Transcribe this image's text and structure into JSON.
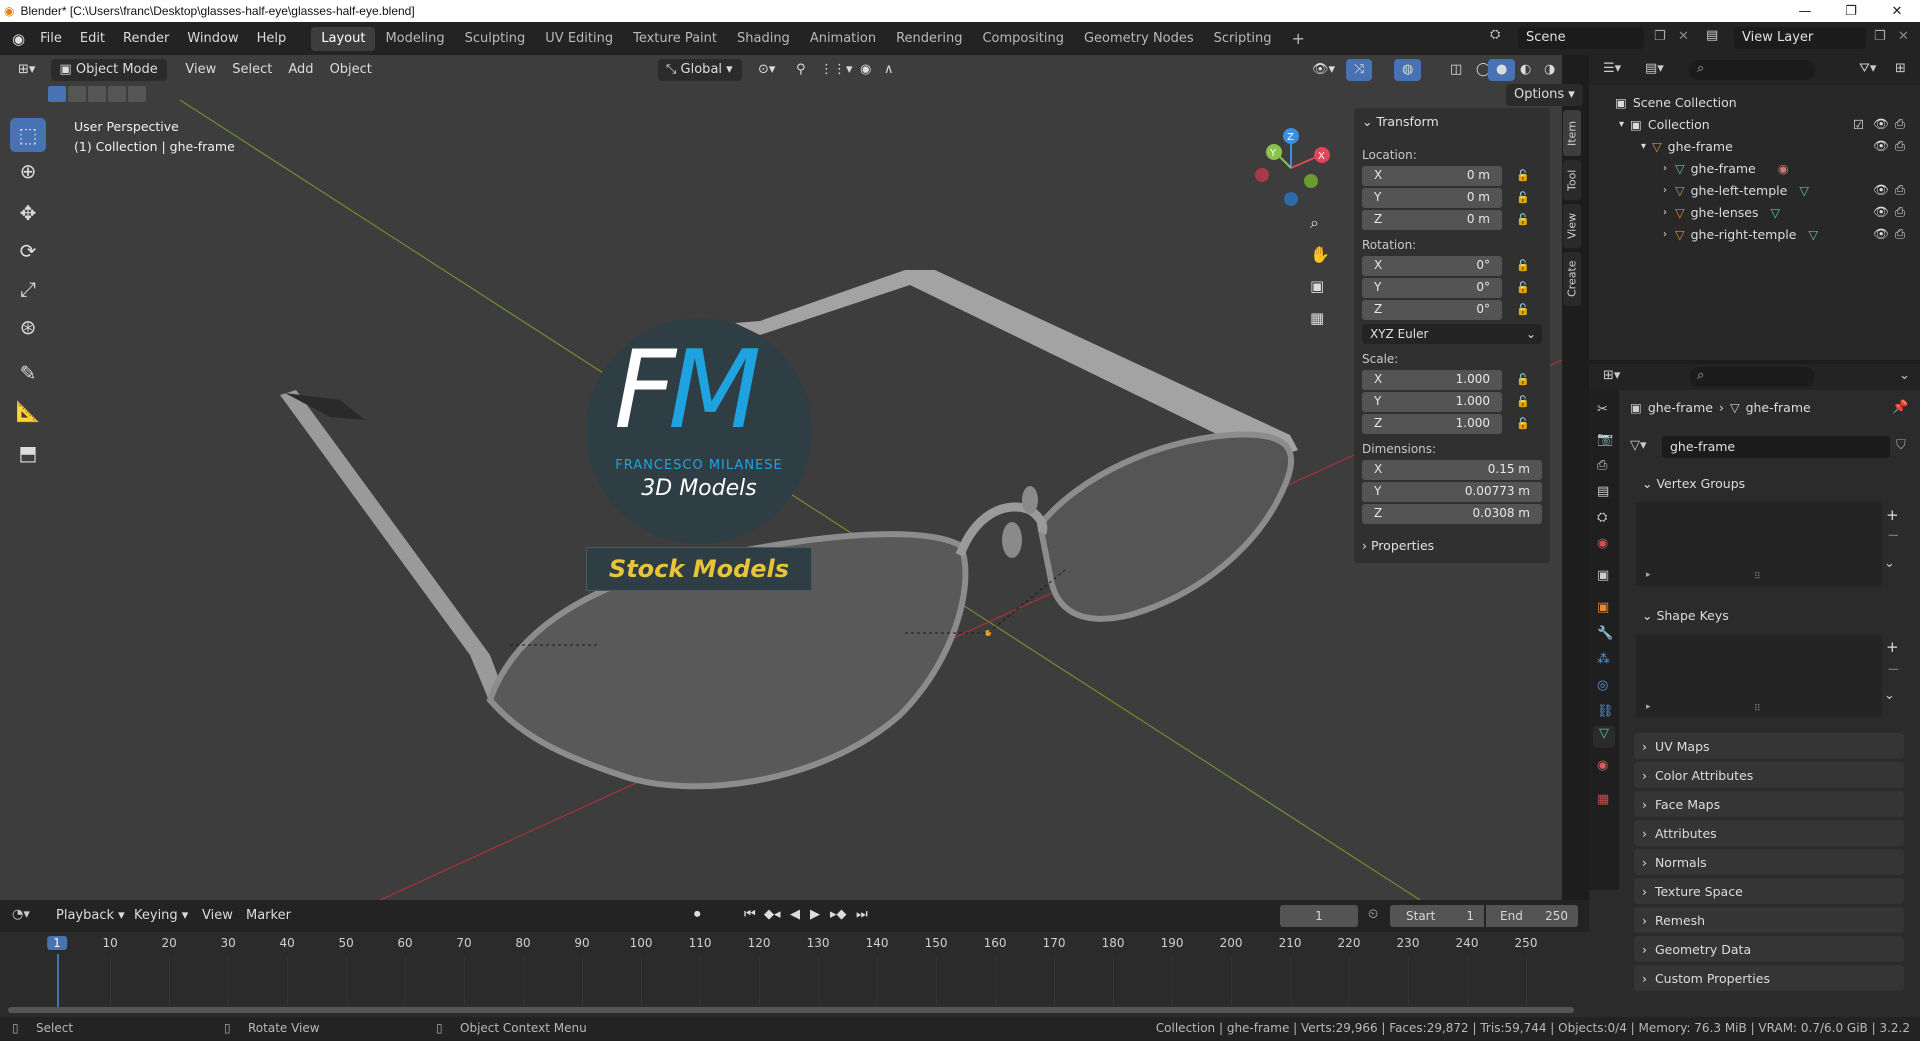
{
  "titlebar": {
    "title": "Blender* [C:\\Users\\franc\\Desktop\\glasses-half-eye\\glasses-half-eye.blend]",
    "minimize": "—",
    "maximize": "❐",
    "close": "✕"
  },
  "menu": [
    "File",
    "Edit",
    "Render",
    "Window",
    "Help"
  ],
  "workspaces": [
    "Layout",
    "Modeling",
    "Sculpting",
    "UV Editing",
    "Texture Paint",
    "Shading",
    "Animation",
    "Rendering",
    "Compositing",
    "Geometry Nodes",
    "Scripting"
  ],
  "active_workspace": "Layout",
  "add_workspace": "+",
  "scene": "Scene",
  "view_layer": "View Layer",
  "viewport_header": {
    "mode": "Object Mode",
    "view": "View",
    "select": "Select",
    "add": "Add",
    "object": "Object",
    "orientation": "Global",
    "options": "Options"
  },
  "viewport": {
    "perspective": "User Perspective",
    "collection_info": "(1) Collection | ghe-frame"
  },
  "watermark": {
    "letters_f": "F",
    "letters_m": "M",
    "author": "FRANCESCO MILANESE",
    "subtitle": "3D Models",
    "banner": "Stock Models"
  },
  "gizmo": {
    "x": "X",
    "y": "Y",
    "z": "Z"
  },
  "npanel": {
    "transform_header": "Transform",
    "location_label": "Location:",
    "location": [
      {
        "axis": "X",
        "value": "0 m"
      },
      {
        "axis": "Y",
        "value": "0 m"
      },
      {
        "axis": "Z",
        "value": "0 m"
      }
    ],
    "rotation_label": "Rotation:",
    "rotation": [
      {
        "axis": "X",
        "value": "0°"
      },
      {
        "axis": "Y",
        "value": "0°"
      },
      {
        "axis": "Z",
        "value": "0°"
      }
    ],
    "rotation_mode": "XYZ Euler",
    "scale_label": "Scale:",
    "scale": [
      {
        "axis": "X",
        "value": "1.000"
      },
      {
        "axis": "Y",
        "value": "1.000"
      },
      {
        "axis": "Z",
        "value": "1.000"
      }
    ],
    "dimensions_label": "Dimensions:",
    "dimensions": [
      {
        "axis": "X",
        "value": "0.15 m"
      },
      {
        "axis": "Y",
        "value": "0.00773 m"
      },
      {
        "axis": "Z",
        "value": "0.0308 m"
      }
    ],
    "properties_header": "Properties",
    "tabs": [
      "Item",
      "Tool",
      "View",
      "Create"
    ]
  },
  "outliner": {
    "scene_collection": "Scene Collection",
    "collection": "Collection",
    "items": [
      {
        "name": "ghe-frame",
        "level": 2
      },
      {
        "name": "ghe-frame",
        "level": 3
      },
      {
        "name": "ghe-left-temple",
        "level": 3
      },
      {
        "name": "ghe-lenses",
        "level": 3
      },
      {
        "name": "ghe-right-temple",
        "level": 3
      }
    ]
  },
  "properties": {
    "breadcrumb_object": "ghe-frame",
    "breadcrumb_data": "ghe-frame",
    "mesh_name": "ghe-frame",
    "vertex_groups": "Vertex Groups",
    "shape_keys": "Shape Keys",
    "sections": [
      "UV Maps",
      "Color Attributes",
      "Face Maps",
      "Attributes",
      "Normals",
      "Texture Space",
      "Remesh",
      "Geometry Data",
      "Custom Properties"
    ]
  },
  "timeline": {
    "playback": "Playback",
    "keying": "Keying",
    "view": "View",
    "marker": "Marker",
    "current_frame": "1",
    "start_label": "Start",
    "start": "1",
    "end_label": "End",
    "end": "250",
    "ticks": [
      "1",
      "10",
      "20",
      "30",
      "40",
      "50",
      "60",
      "70",
      "80",
      "90",
      "100",
      "110",
      "120",
      "130",
      "140",
      "150",
      "160",
      "170",
      "180",
      "190",
      "200",
      "210",
      "220",
      "230",
      "240",
      "250"
    ]
  },
  "statusbar": {
    "select": "Select",
    "rotate": "Rotate View",
    "context_menu": "Object Context Menu",
    "stats": "Collection | ghe-frame | Verts:29,966 | Faces:29,872 | Tris:59,744 | Objects:0/4 | Memory: 76.3 MiB | VRAM: 0.7/6.0 GiB | 3.2.2"
  },
  "colors": {
    "accent": "#4772b3",
    "x_axis": "#e0455a",
    "y_axis": "#8bc34a",
    "z_axis": "#3d8fe0",
    "watermark_blue": "#1fa3e0",
    "watermark_yellow": "#e8c43a"
  }
}
